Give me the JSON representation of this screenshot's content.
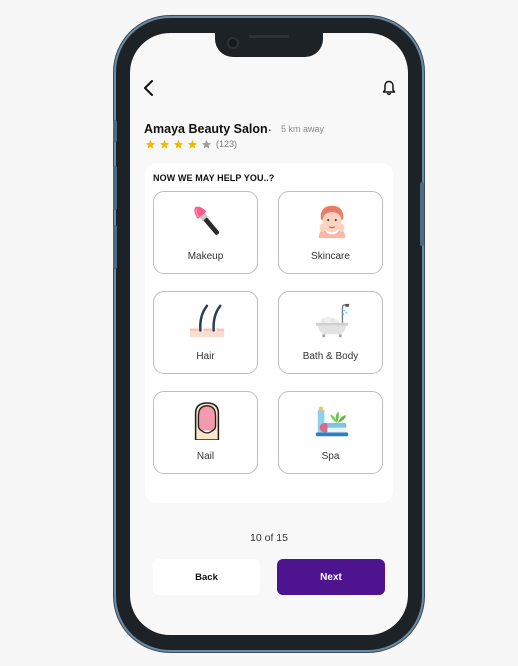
{
  "salon": {
    "name": "Amaya Beauty Salon",
    "separator": ".",
    "distance": "5 km away",
    "rating_stars": 4,
    "rating_max": 5,
    "rating_count": "(123)"
  },
  "section_title": "NOW WE MAY HELP YOU..?",
  "services": [
    {
      "label": "Makeup",
      "icon": "makeup-brush-icon"
    },
    {
      "label": "Skincare",
      "icon": "face-skincare-icon"
    },
    {
      "label": "Hair",
      "icon": "hair-strands-icon"
    },
    {
      "label": "Bath & Body",
      "icon": "bathtub-icon"
    },
    {
      "label": "Nail",
      "icon": "nail-icon"
    },
    {
      "label": "Spa",
      "icon": "spa-products-icon"
    }
  ],
  "pagination": "10 of 15",
  "actions": {
    "back_label": "Back",
    "next_label": "Next"
  },
  "colors": {
    "primary": "#4e138f",
    "star_filled": "#f5b800",
    "star_empty": "#9e9e9e"
  }
}
